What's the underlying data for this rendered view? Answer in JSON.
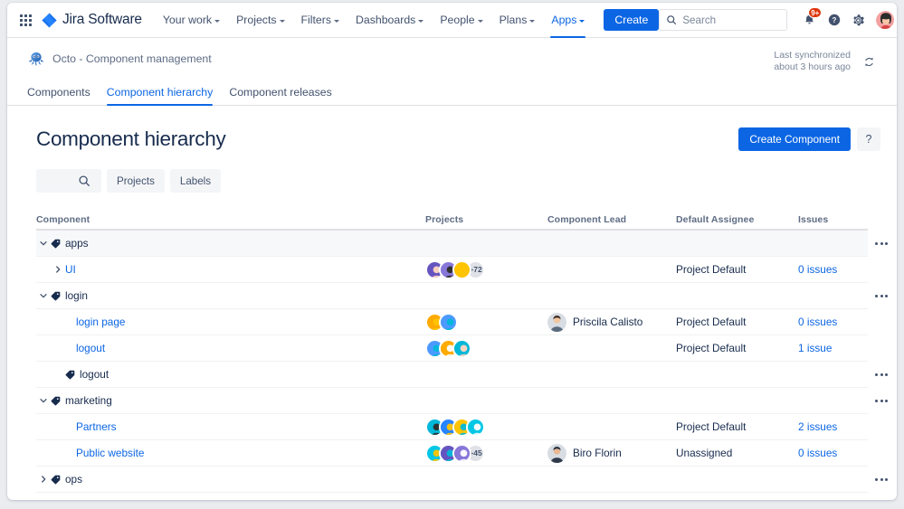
{
  "nav": {
    "apps_grid_icon": "apps-grid-icon",
    "brand": "Jira Software",
    "items": [
      {
        "label": "Your work",
        "has_caret": true,
        "active": false
      },
      {
        "label": "Projects",
        "has_caret": true,
        "active": false
      },
      {
        "label": "Filters",
        "has_caret": true,
        "active": false
      },
      {
        "label": "Dashboards",
        "has_caret": true,
        "active": false
      },
      {
        "label": "People",
        "has_caret": true,
        "active": false
      },
      {
        "label": "Plans",
        "has_caret": true,
        "active": false
      },
      {
        "label": "Apps",
        "has_caret": true,
        "active": true
      }
    ],
    "create_label": "Create",
    "search_placeholder": "Search",
    "notification_badge": "9+",
    "icons": {
      "search": "search-icon",
      "notifications": "notification-bell-icon",
      "help": "help-icon",
      "settings": "gear-icon",
      "profile": "user-avatar"
    }
  },
  "project_header": {
    "icon": "octopus-app-icon",
    "name": "Octo - Component management",
    "sync_line1": "Last synchronized",
    "sync_line2": "about 3 hours ago",
    "sync_icon": "refresh-icon"
  },
  "tabs": [
    {
      "label": "Components",
      "active": false
    },
    {
      "label": "Component hierarchy",
      "active": true
    },
    {
      "label": "Component releases",
      "active": false
    }
  ],
  "title": "Component hierarchy",
  "actions": {
    "create_component": "Create Component",
    "help": "?"
  },
  "filters": {
    "search_icon": "search-icon",
    "chips": [
      "Projects",
      "Labels"
    ]
  },
  "table": {
    "headers": [
      "Component",
      "Projects",
      "Component Lead",
      "Default Assignee",
      "Issues"
    ],
    "rows": [
      {
        "type": "group",
        "indent": 0,
        "label": "apps",
        "expanded": true,
        "highlighted": true,
        "chevron": "chevron-down",
        "projects": [],
        "overflow": "",
        "lead": "",
        "assignee": "",
        "issues": "",
        "menu": true
      },
      {
        "type": "item",
        "indent": 1,
        "label": "UI",
        "expanded": false,
        "highlighted": false,
        "chevron": "chevron-right",
        "projects": [
          "#6554c0",
          "#8777d9",
          "#ffc400"
        ],
        "overflow": "+72",
        "lead": "",
        "assignee": "Project Default",
        "issues": "0 issues",
        "menu": false
      },
      {
        "type": "group",
        "indent": 0,
        "label": "login",
        "expanded": true,
        "highlighted": false,
        "chevron": "chevron-down",
        "projects": [],
        "overflow": "",
        "lead": "",
        "assignee": "",
        "issues": "",
        "menu": true
      },
      {
        "type": "item",
        "indent": 2,
        "label": "login page",
        "expanded": false,
        "highlighted": false,
        "chevron": "none",
        "projects": [
          "#ffab00",
          "#4c9aff"
        ],
        "overflow": "",
        "lead": "Priscila Calisto",
        "assignee": "Project Default",
        "issues": "0 issues",
        "menu": false
      },
      {
        "type": "item",
        "indent": 2,
        "label": "logout",
        "expanded": false,
        "highlighted": false,
        "chevron": "none",
        "projects": [
          "#4c9aff",
          "#ffab00",
          "#00b8d9"
        ],
        "overflow": "",
        "lead": "",
        "assignee": "Project Default",
        "issues": "1 issue",
        "menu": false
      },
      {
        "type": "group",
        "indent": 1,
        "label": "logout",
        "expanded": false,
        "highlighted": false,
        "chevron": "none",
        "projects": [],
        "overflow": "",
        "lead": "",
        "assignee": "",
        "issues": "",
        "menu": true
      },
      {
        "type": "group",
        "indent": 0,
        "label": "marketing",
        "expanded": true,
        "highlighted": false,
        "chevron": "chevron-down",
        "projects": [],
        "overflow": "",
        "lead": "",
        "assignee": "",
        "issues": "",
        "menu": true
      },
      {
        "type": "item",
        "indent": 2,
        "label": "Partners",
        "expanded": false,
        "highlighted": false,
        "chevron": "none",
        "projects": [
          "#00b8d9",
          "#2684ff",
          "#ffc400",
          "#00c7e6"
        ],
        "overflow": "",
        "lead": "",
        "assignee": "Project Default",
        "issues": "2 issues",
        "menu": false
      },
      {
        "type": "item",
        "indent": 2,
        "label": "Public website",
        "expanded": false,
        "highlighted": false,
        "chevron": "none",
        "projects": [
          "#00c7e6",
          "#6554c0",
          "#8777d9"
        ],
        "overflow": "+45",
        "lead": "Biro Florin",
        "assignee": "Unassigned",
        "issues": "0 issues",
        "menu": false
      },
      {
        "type": "group",
        "indent": 0,
        "label": "ops",
        "expanded": false,
        "highlighted": false,
        "chevron": "chevron-right",
        "projects": [],
        "overflow": "",
        "lead": "",
        "assignee": "",
        "issues": "",
        "menu": true
      }
    ]
  },
  "colors": {
    "brand_blue": "#0c66e4",
    "link_blue": "#0c66e4",
    "text_dark": "#172b4d",
    "text_muted": "#5e6c84",
    "badge_red": "#de350b",
    "row_highlight": "#f7f8f9"
  }
}
